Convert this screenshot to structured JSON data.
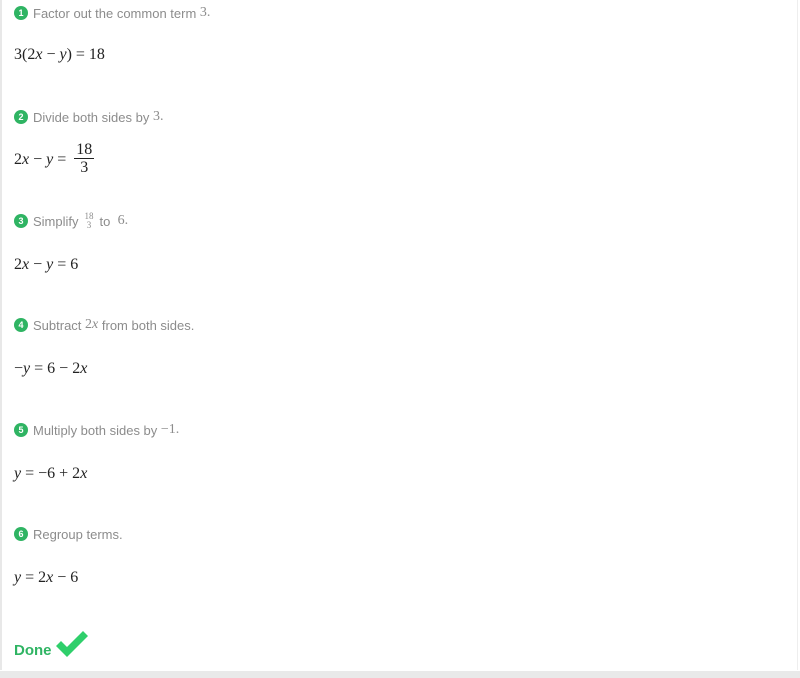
{
  "steps": [
    {
      "number": "1",
      "instruction_text": "Factor out the common term",
      "instruction_math": "3.",
      "result": {
        "pre": "3(2",
        "var1": "x",
        "mid": " − ",
        "var2": "y",
        "post": ") = 18"
      }
    },
    {
      "number": "2",
      "instruction_text": "Divide both sides by",
      "instruction_math": "3.",
      "result": {
        "pre": "2",
        "var1": "x",
        "mid": " − ",
        "var2": "y",
        "post": " = ",
        "frac_num": "18",
        "frac_den": "3"
      }
    },
    {
      "number": "3",
      "instruction_text": "Simplify",
      "instruction_frac_num": "18",
      "instruction_frac_den": "3",
      "instruction_to": "to",
      "instruction_math": "6.",
      "result": {
        "pre": "2",
        "var1": "x",
        "mid": " − ",
        "var2": "y",
        "post": " = 6"
      }
    },
    {
      "number": "4",
      "instruction_text": "Subtract",
      "instruction_math_pre": "2",
      "instruction_math_var": "x",
      "instruction_text_post": "from both sides.",
      "result": {
        "pre": "−",
        "var1": "y",
        "mid": " = 6 − 2",
        "var2": "x",
        "post": ""
      }
    },
    {
      "number": "5",
      "instruction_text": "Multiply both sides by",
      "instruction_math": "−1.",
      "result": {
        "pre": "",
        "var1": "y",
        "mid": " = −6 + 2",
        "var2": "x",
        "post": ""
      }
    },
    {
      "number": "6",
      "instruction_text": "Regroup terms.",
      "result": {
        "pre": "",
        "var1": "y",
        "mid": " = 2",
        "var2": "x",
        "post": " − 6"
      }
    }
  ],
  "done": {
    "label": "Done",
    "icon": "checkmark-icon"
  },
  "colors": {
    "accent": "#2fb463",
    "instruction": "#8c8c8c",
    "equation": "#222222"
  }
}
